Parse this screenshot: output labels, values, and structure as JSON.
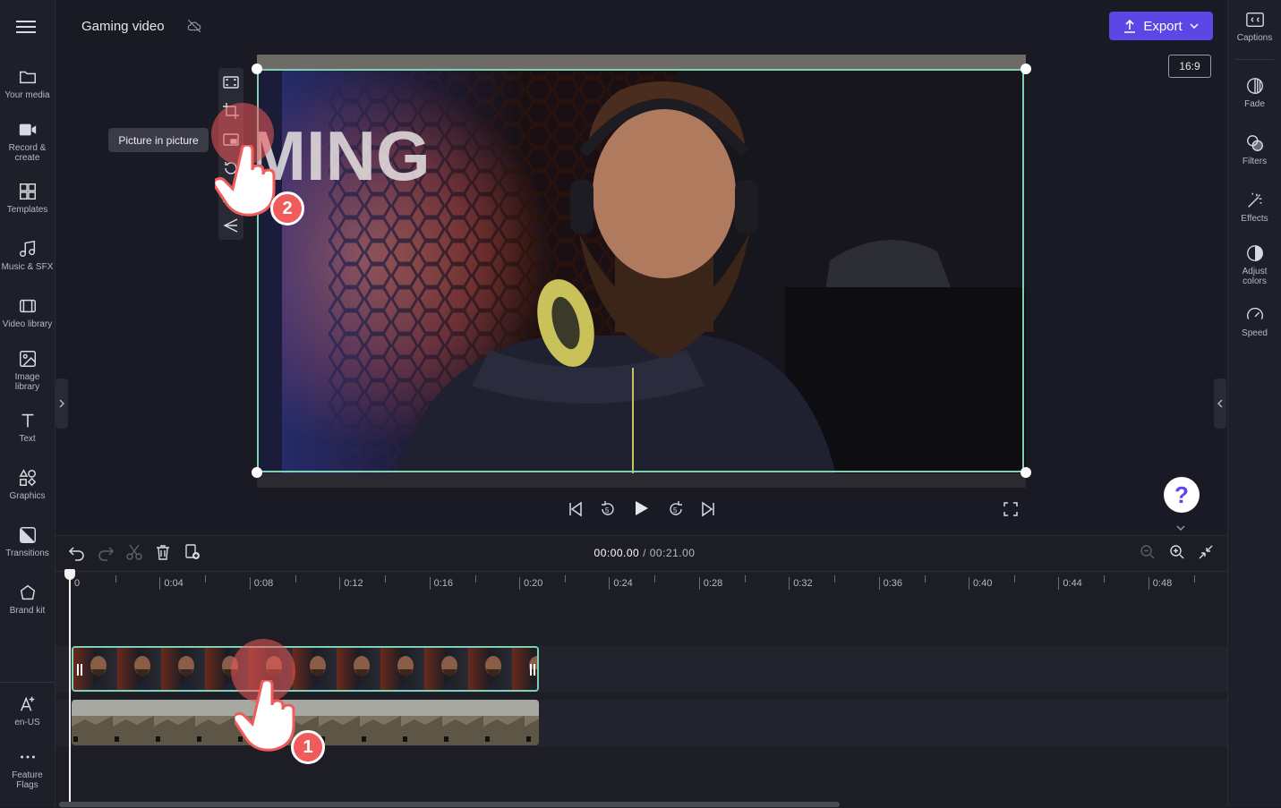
{
  "project": {
    "title": "Gaming video"
  },
  "left_sidebar": {
    "items": [
      {
        "label": "Your media",
        "icon": "folder-icon"
      },
      {
        "label": "Record &\ncreate",
        "icon": "camera-icon"
      },
      {
        "label": "Templates",
        "icon": "templates-icon"
      },
      {
        "label": "Music & SFX",
        "icon": "music-icon"
      },
      {
        "label": "Video library",
        "icon": "film-icon"
      },
      {
        "label": "Image\nlibrary",
        "icon": "image-icon"
      },
      {
        "label": "Text",
        "icon": "text-icon"
      },
      {
        "label": "Graphics",
        "icon": "shapes-icon"
      },
      {
        "label": "Transitions",
        "icon": "transitions-icon"
      },
      {
        "label": "Brand kit",
        "icon": "brand-kit-icon"
      }
    ],
    "bottom": [
      {
        "label": "en-US",
        "icon": "language-icon"
      },
      {
        "label": "Feature\nFlags",
        "icon": "more-dots-icon"
      }
    ]
  },
  "right_sidebar": {
    "items": [
      {
        "label": "Captions",
        "icon": "cc-icon"
      },
      {
        "label": "Fade",
        "icon": "fade-icon"
      },
      {
        "label": "Filters",
        "icon": "filters-icon"
      },
      {
        "label": "Effects",
        "icon": "magic-wand-icon"
      },
      {
        "label": "Adjust\ncolors",
        "icon": "contrast-icon"
      },
      {
        "label": "Speed",
        "icon": "speedometer-icon"
      }
    ]
  },
  "header": {
    "export_label": "Export",
    "aspect_ratio": "16:9"
  },
  "preview": {
    "tooltip": "Picture in picture",
    "toolbar": [
      "fit-icon",
      "crop-icon",
      "picture-in-picture-icon",
      "rotate-icon",
      "flip-icon",
      "align-icon"
    ]
  },
  "playback": {
    "current_time": "00:00.00",
    "separator": " / ",
    "total_time": "00:21.00"
  },
  "timeline": {
    "ruler": [
      "0",
      "0:04",
      "0:08",
      "0:12",
      "0:16",
      "0:20",
      "0:24",
      "0:28",
      "0:32",
      "0:36",
      "0:40",
      "0:44",
      "0:48"
    ]
  },
  "overlay": {
    "step_1": "1",
    "step_2": "2"
  },
  "help_label": "?",
  "colors": {
    "accent": "#5a47e6",
    "selection": "#7fd1b4",
    "marker": "#f05b5b"
  }
}
